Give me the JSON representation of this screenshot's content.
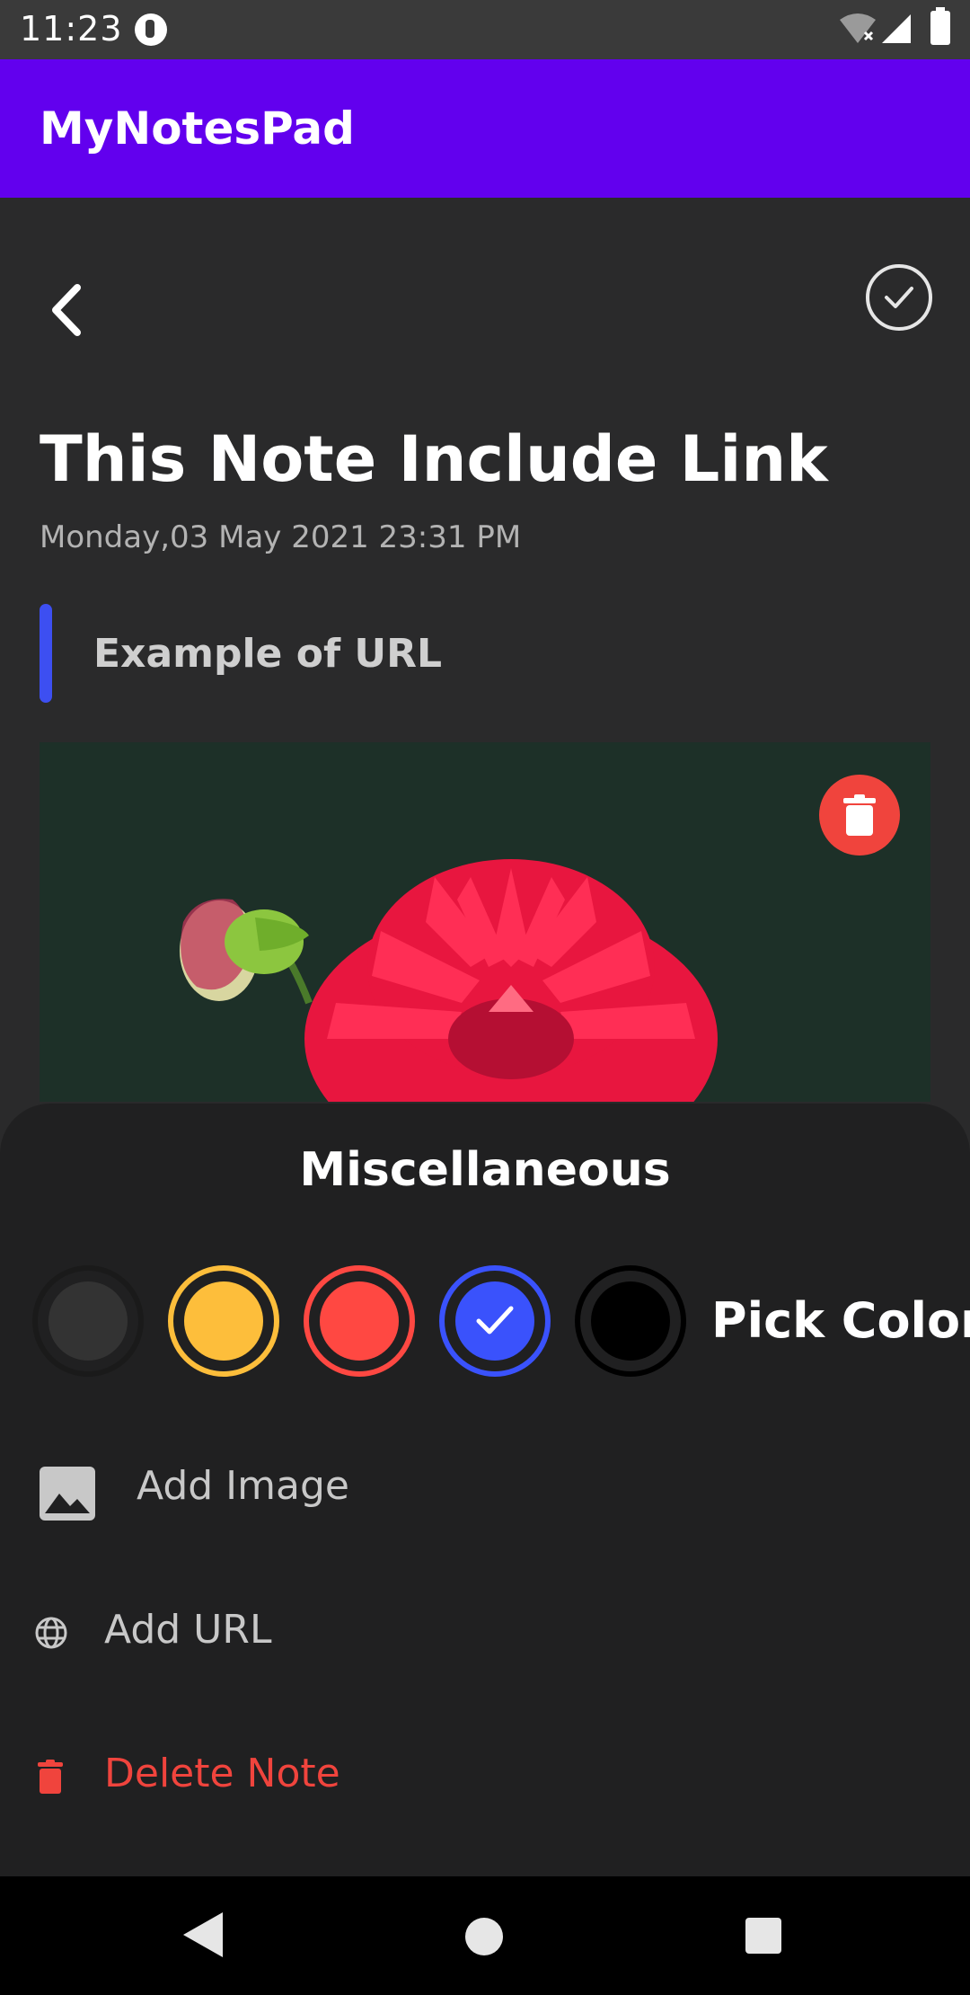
{
  "status_bar": {
    "time": "11:23"
  },
  "app_bar": {
    "title": "MyNotesPad"
  },
  "note": {
    "title": "This Note Include Link",
    "date": "Monday,03 May 2021 23:31 PM",
    "subtitle": "Example of URL",
    "indicator_color": "#3d4ff1"
  },
  "sheet": {
    "title": "Miscellaneous",
    "swatches": [
      {
        "color": "#333333",
        "selected": false
      },
      {
        "color": "#fdbe3b",
        "selected": false
      },
      {
        "color": "#ff4842",
        "selected": false
      },
      {
        "color": "#3a52fc",
        "selected": true
      },
      {
        "color": "#000000",
        "selected": false
      }
    ],
    "pick_color_label": "Pick Color",
    "add_image_label": "Add Image",
    "add_url_label": "Add URL",
    "delete_note_label": "Delete Note"
  },
  "colors": {
    "app_bar": "#6200ee",
    "background": "#2a2a2b",
    "sheet": "#202021",
    "danger": "#f0443d"
  },
  "icons": [
    "back-arrow-icon",
    "check-circle-icon",
    "trash-icon",
    "image-icon",
    "globe-icon",
    "nav-back-icon",
    "nav-home-icon",
    "nav-recents-icon"
  ]
}
